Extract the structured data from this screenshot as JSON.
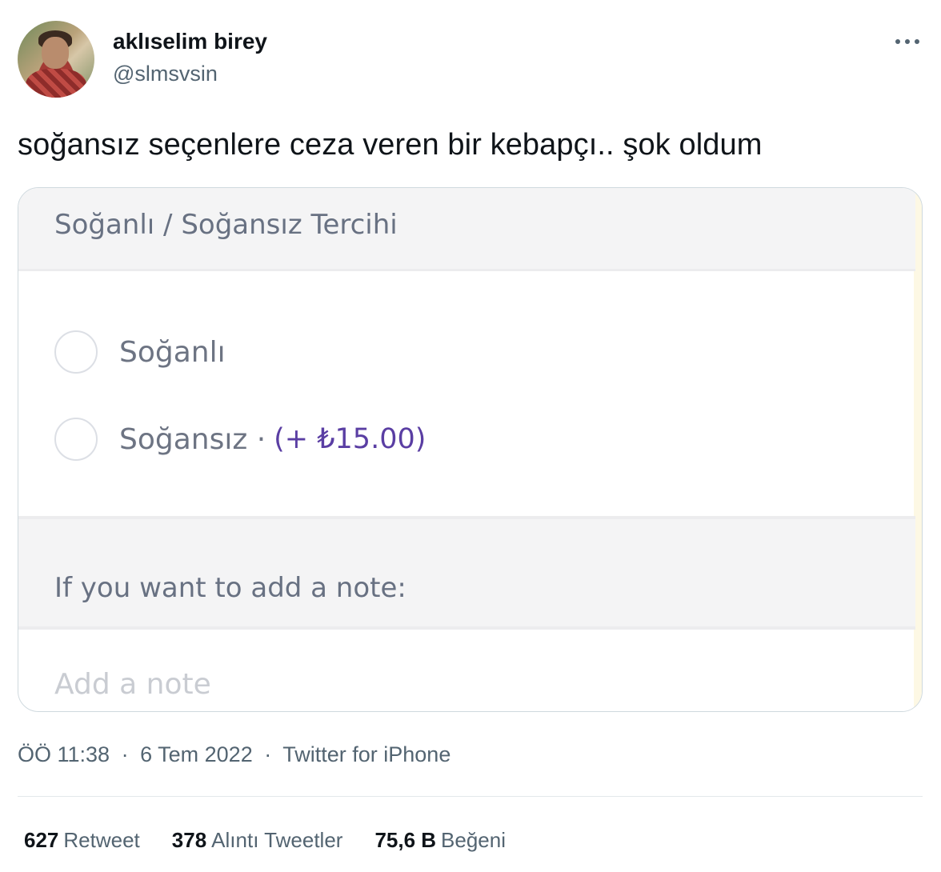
{
  "author": {
    "display_name": "aklıselim birey",
    "handle": "@slmsvsin",
    "avatar_icon": "profile-photo"
  },
  "tweet": {
    "text": "soğansız seçenlere ceza veren bir kebapçı.. şok oldum"
  },
  "media": {
    "section_title": "Soğanlı / Soğansız Tercihi",
    "options": [
      {
        "label": "Soğanlı",
        "price": ""
      },
      {
        "label": "Soğansız ·",
        "price": "(+ ₺15.00)"
      }
    ],
    "note_title": "If you want to add a note:",
    "note_placeholder": "Add a note",
    "price_color": "#5a3ea3"
  },
  "meta": {
    "time": "ÖÖ 11:38",
    "date": "6 Tem 2022",
    "source": "Twitter for iPhone",
    "separator": "·"
  },
  "stats": [
    {
      "count": "627",
      "label": "Retweet"
    },
    {
      "count": "378",
      "label": "Alıntı Tweetler"
    },
    {
      "count": "75,6 B",
      "label": "Beğeni"
    }
  ]
}
